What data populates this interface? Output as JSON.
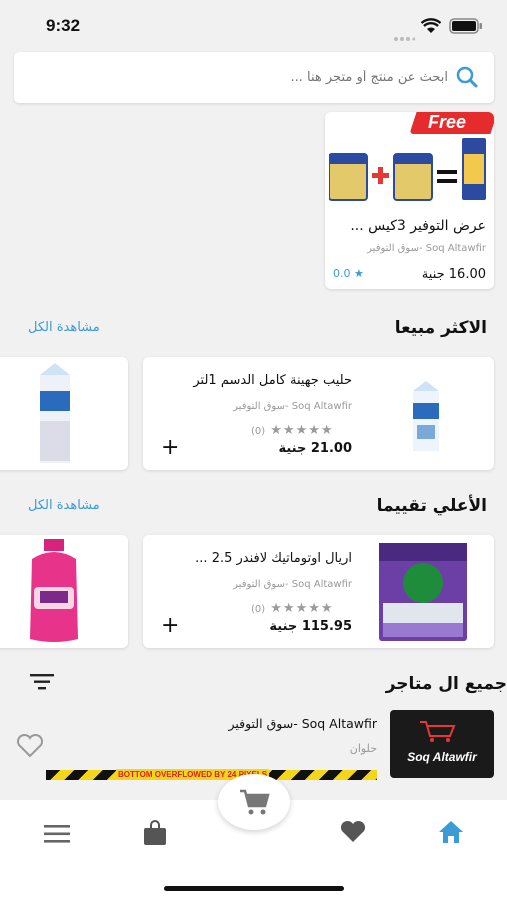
{
  "status_bar": {
    "time": "9:32"
  },
  "search": {
    "placeholder": "ابحث عن منتج أو متجر هنا ..."
  },
  "offer": {
    "badge": "Free",
    "title": "عرض التوفير 3كيس ...",
    "store": "Soq Altawfir -سوق التوفير",
    "price": "16.00 جنية",
    "rating": "0.0"
  },
  "best_selling": {
    "title": "الاكثر مبيعا",
    "see_all": "مشاهدة الكل",
    "item": {
      "name": "حليب جهينة كامل الدسم 1لتر",
      "store": "Soq Altawfir -سوق التوفير",
      "rating_count": "(0)",
      "price": "21.00 جنية"
    }
  },
  "top_rated": {
    "title": "الأعلي تقييما",
    "see_all": "مشاهدة الكل",
    "item": {
      "name": "اريال اوتوماتيك لافندر 2.5 ...",
      "store": "Soq Altawfir -سوق التوفير",
      "rating_count": "(0)",
      "price": "115.95 جنية"
    }
  },
  "all_stores": {
    "title": "جميع ال متاجر",
    "store": {
      "name": "Soq Altawfir -سوق التوفير",
      "location": "حلوان",
      "logo_text": "Soq Altawfir"
    },
    "overflow_warning": "BOTTOM OVERFLOWED BY 24 PIXELS"
  },
  "bottom_nav": {
    "items": [
      "menu-icon",
      "bag-icon",
      "cart-icon",
      "heart-icon",
      "home-icon"
    ],
    "active_color": "#3a9bd5"
  }
}
